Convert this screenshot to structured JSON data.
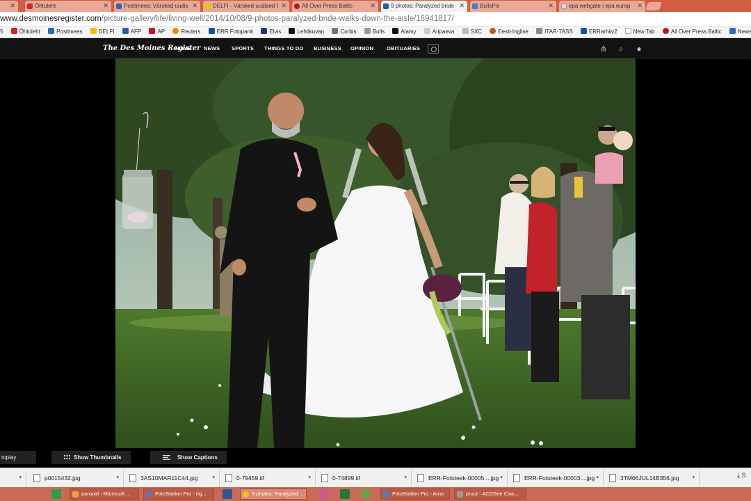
{
  "colors": {
    "titlebar": "#d35d44",
    "site_nav": "#121212",
    "taskbar": "#c96a55"
  },
  "browser": {
    "tabs": [
      {
        "label": "Õhtuleht",
        "active": false
      },
      {
        "label": "Postimees: Värsked uudis",
        "active": false
      },
      {
        "label": "DELFI - Värsked uudised f",
        "active": false
      },
      {
        "label": "All Over Press Baltic",
        "active": false
      },
      {
        "label": "9 photos: Paralyzed bride",
        "active": true
      },
      {
        "label": "BullsPix",
        "active": false
      },
      {
        "label": "epa webgate | epa europ",
        "active": false
      }
    ],
    "address": {
      "host": "www.desmoinesregister.com",
      "path": "/picture-gallery/life/living-well/2014/10/08/9-photos-paralyzed-bride-walks-down-the-aisle/16941817/"
    },
    "bookmarks": [
      "Õhtuleht",
      "Postimees",
      "DELFI",
      "AFP",
      "AP",
      "Reuters",
      "ERR Fotopank",
      "Elvis",
      "Lehtikuvan",
      "Corbis",
      "Bulls",
      "Alamy",
      "Aripaeva",
      "SXC",
      "Eesti-Inglise",
      "ITAR-TASS",
      "ERRarhiiv2",
      "New Tab",
      "All Over Press Baltic",
      "Newsline Photo Ag"
    ]
  },
  "site": {
    "logo": "The Des Moines Register",
    "nav": [
      "HOME",
      "NEWS",
      "SPORTS",
      "THINGS TO DO",
      "BUSINESS",
      "OPINION",
      "OBITUARIES"
    ]
  },
  "gallery": {
    "autoplay_label": "toplay",
    "thumbnails_label": "Show Thumbnails",
    "captions_label": "Show Captions"
  },
  "downloads": {
    "files": [
      "p0015432.jpg",
      "3AS10MAR11C44.jpg",
      "0-79459.tif",
      "0-74899.tif",
      "ERR-Fototeek-00005....jpg",
      "ERR-Fototeek-00003....jpg",
      "3TM06JUL14B356.jpg"
    ],
    "show_all": "S"
  },
  "taskbar": {
    "items": [
      {
        "label": "parooid - Microsoft ...",
        "active": false
      },
      {
        "label": "FotoStation Pro - rig...",
        "active": false
      },
      {
        "label": "9 photos: Paralyzed ...",
        "active": true
      },
      {
        "label": "FotoStation Pro - Arno",
        "active": false
      },
      {
        "label": "pruut - ACDSee Clas...",
        "active": false
      }
    ]
  }
}
